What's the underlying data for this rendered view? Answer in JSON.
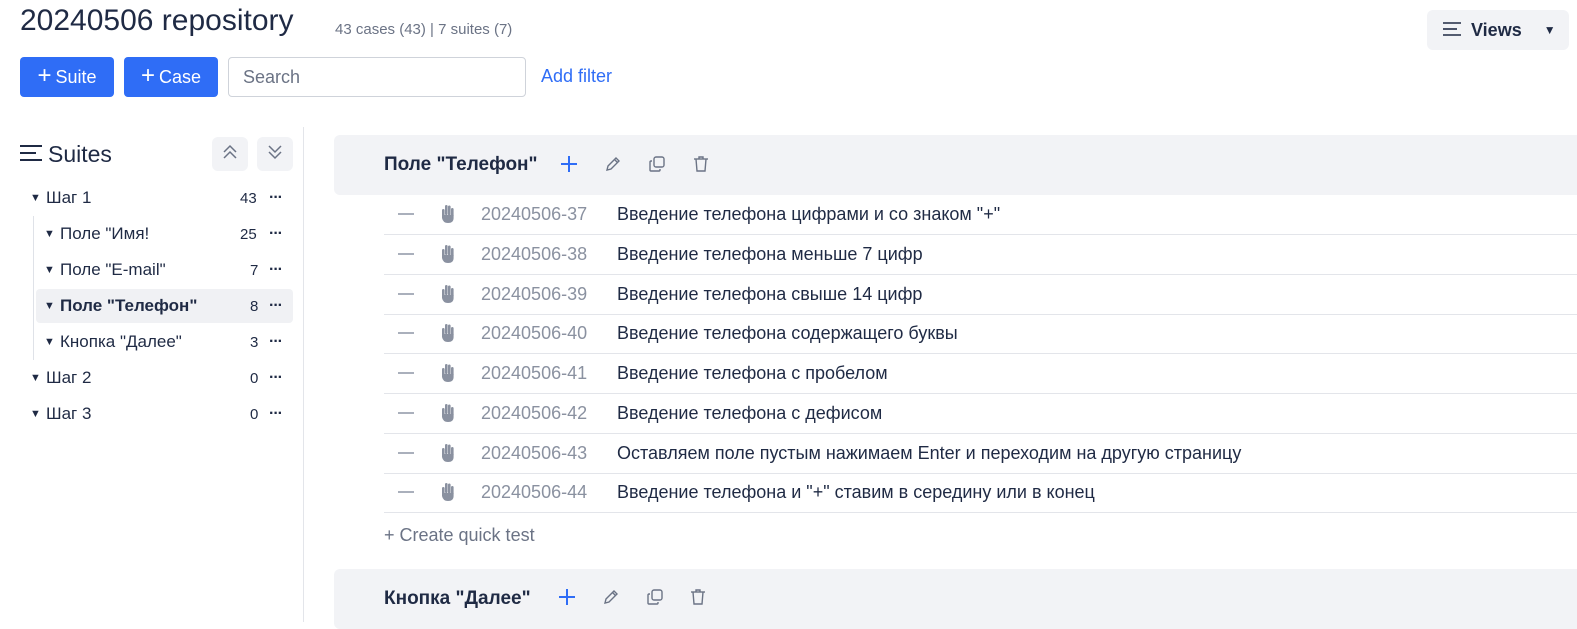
{
  "header": {
    "title": "20240506 repository",
    "subtitle": "43 cases (43) | 7 suites (7)",
    "views_label": "Views"
  },
  "toolbar": {
    "suite_button": "Suite",
    "case_button": "Case",
    "search_placeholder": "Search",
    "add_filter": "Add filter"
  },
  "sidebar": {
    "title": "Suites",
    "items": [
      {
        "label": "Шаг 1",
        "count": "43"
      },
      {
        "label": "Поле \"Имя!",
        "count": "25"
      },
      {
        "label": "Поле \"E-mail\"",
        "count": "7"
      },
      {
        "label": "Поле \"Телефон\"",
        "count": "8"
      },
      {
        "label": "Кнопка \"Далее\"",
        "count": "3"
      },
      {
        "label": "Шаг 2",
        "count": "0"
      },
      {
        "label": "Шаг 3",
        "count": "0"
      }
    ]
  },
  "main": {
    "suite1_title": "Поле \"Телефон\"",
    "cases": [
      {
        "id": "20240506-37",
        "title": "Введение телефона цифрами и со знаком \"+\""
      },
      {
        "id": "20240506-38",
        "title": "Введение телефона меньше 7 цифр"
      },
      {
        "id": "20240506-39",
        "title": "Введение телефона свыше 14 цифр"
      },
      {
        "id": "20240506-40",
        "title": "Введение телефона содержащего буквы"
      },
      {
        "id": "20240506-41",
        "title": "Введение телефона с пробелом"
      },
      {
        "id": "20240506-42",
        "title": "Введение телефона с дефисом"
      },
      {
        "id": "20240506-43",
        "title": "Оставляем поле пустым нажимаем Enter и переходим на другую страницу"
      },
      {
        "id": "20240506-44",
        "title": "Введение телефона и \"+\" ставим в середину или в конец"
      }
    ],
    "quick_test": "+ Create quick test",
    "suite2_title": "Кнопка \"Далее\""
  },
  "colors": {
    "accent": "#2f6df6",
    "text": "#1f2a44",
    "muted": "#8a91a0",
    "band": "#f2f3f6"
  },
  "icons": [
    "plus-icon",
    "list-icon",
    "chevron-down-icon",
    "collapse-all-icon",
    "expand-all-icon",
    "caret-down-icon",
    "more-icon",
    "pencil-icon",
    "copy-icon",
    "trash-icon",
    "hand-icon",
    "dash-icon"
  ]
}
